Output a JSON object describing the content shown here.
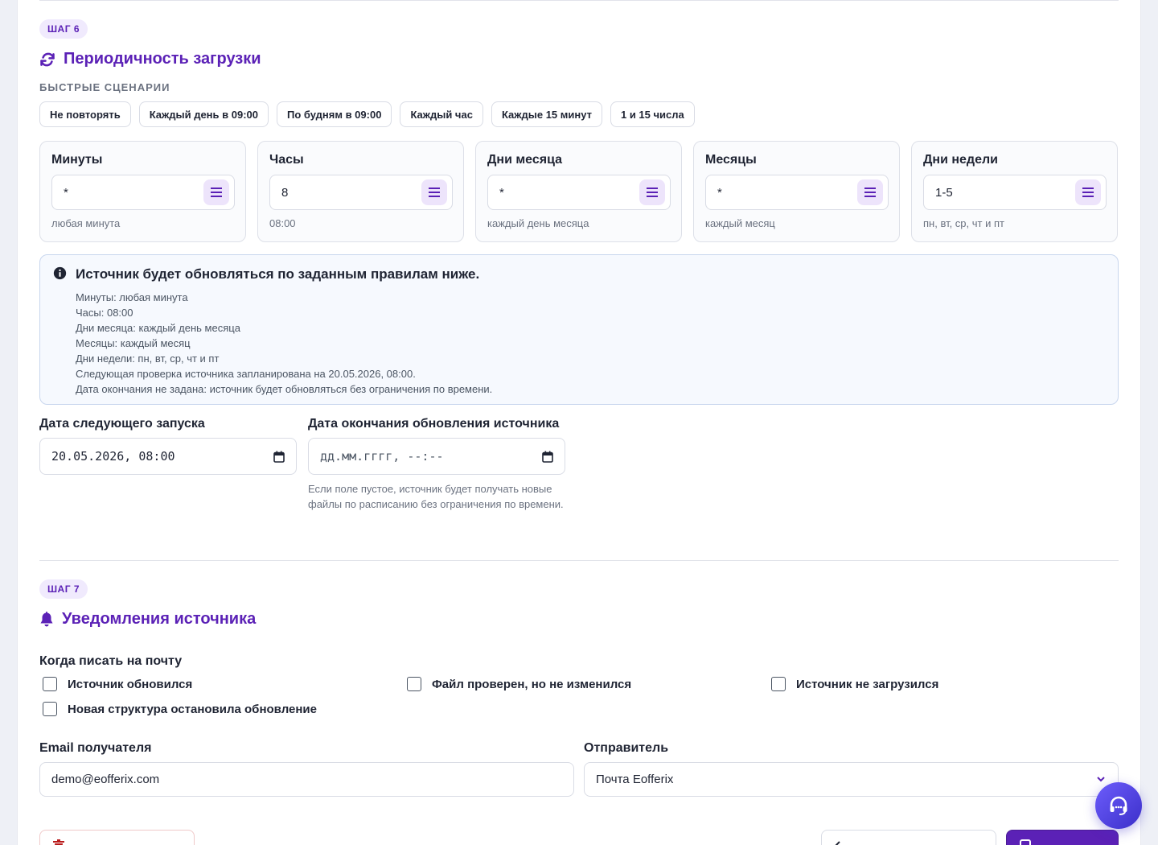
{
  "step6": {
    "badge": "ШАГ 6",
    "title": "Периодичность загрузки",
    "quick_label": "БЫСТРЫЕ СЦЕНАРИИ",
    "quick_scenarios": [
      "Не повторять",
      "Каждый день в 09:00",
      "По будням в 09:00",
      "Каждый час",
      "Каждые 15 минут",
      "1 и 15 числа"
    ],
    "cron_fields": [
      {
        "label": "Минуты",
        "value": "*",
        "hint": "любая минута"
      },
      {
        "label": "Часы",
        "value": "8",
        "hint": "08:00"
      },
      {
        "label": "Дни месяца",
        "value": "*",
        "hint": "каждый день месяца"
      },
      {
        "label": "Месяцы",
        "value": "*",
        "hint": "каждый месяц"
      },
      {
        "label": "Дни недели",
        "value": "1-5",
        "hint": "пн, вт, ср, чт и пт"
      }
    ],
    "info": {
      "title": "Источник будет обновляться по заданным правилам ниже.",
      "lines": [
        "Минуты: любая минута",
        "Часы: 08:00",
        "Дни месяца: каждый день месяца",
        "Месяцы: каждый месяц",
        "Дни недели: пн, вт, ср, чт и пт",
        "Следующая проверка источника запланирована на 20.05.2026, 08:00.",
        "Дата окончания не задана: источник будет обновляться без ограничения по времени."
      ]
    },
    "next_run": {
      "label": "Дата следующего запуска",
      "value": "20.05.2026, 08:00"
    },
    "end_date": {
      "label": "Дата окончания обновления источника",
      "placeholder": "дд.мм.гггг, --:--",
      "help": "Если поле пустое, источник будет получать новые файлы по расписанию без ограничения по времени."
    }
  },
  "step7": {
    "badge": "ШАГ 7",
    "title": "Уведомления источника",
    "when_label": "Когда писать на почту",
    "checkboxes": [
      {
        "label": "Источник обновился",
        "checked": false
      },
      {
        "label": "Файл проверен, но не изменился",
        "checked": false
      },
      {
        "label": "Источник не загрузился",
        "checked": false
      },
      {
        "label": "Новая структура остановила обновление",
        "checked": false
      }
    ],
    "email": {
      "label": "Email получателя",
      "value": "demo@eofferix.com"
    },
    "sender": {
      "label": "Отправитель",
      "value": "Почта Eofferix"
    }
  },
  "colors": {
    "accent": "#5b21b6",
    "accent_light": "#ede4fb",
    "info_bg": "#f6f9fe"
  }
}
